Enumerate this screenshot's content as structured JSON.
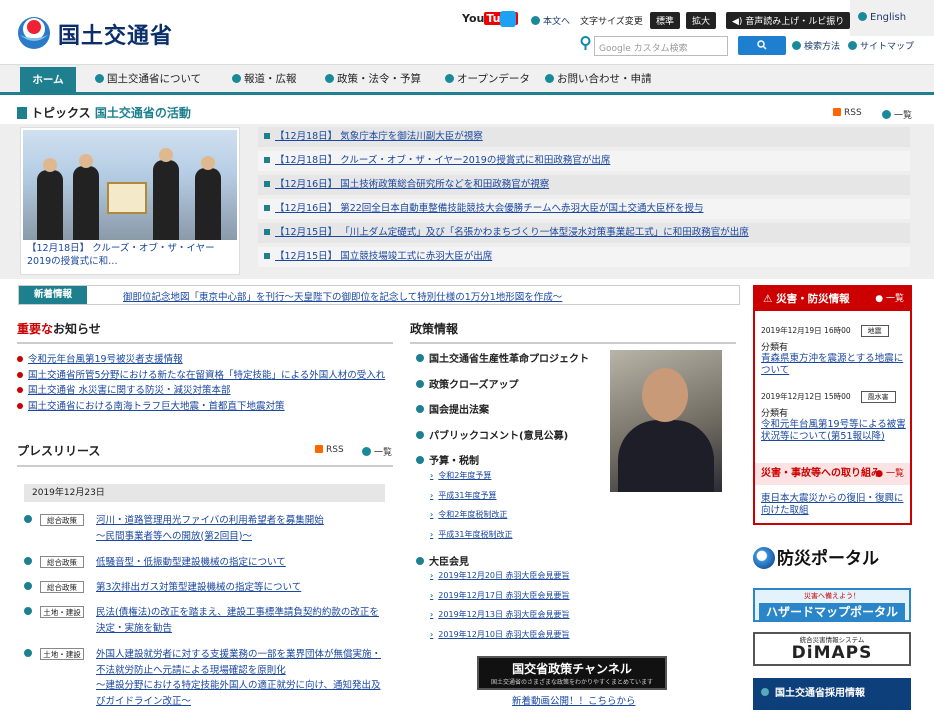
{
  "header": {
    "site_name": "国土交通省",
    "english": "English",
    "youtube": "You",
    "youtube_tube": "Tube",
    "skip_to_main": "本文へ",
    "font_size_label": "文字サイズ変更",
    "font_standard": "標準",
    "font_large": "拡大",
    "read_aloud": "音声読み上げ・ルビ振り",
    "search_placeholder": "Google カスタム検索",
    "search_method": "検索方法",
    "sitemap": "サイトマップ"
  },
  "nav": {
    "home": "ホーム",
    "items": [
      "国土交通省について",
      "報道・広報",
      "政策・法令・予算",
      "オープンデータ",
      "お問い合わせ・申請"
    ]
  },
  "topics": {
    "title": "トピックス",
    "subtitle": "国土交通省の活動",
    "rss": "RSS",
    "list_link": "一覧",
    "photo_caption": "【12月18日】 クルーズ・オブ・ザ・イヤー2019の授賞式に和…",
    "items": [
      "【12月18日】 気象庁本庁を御法川副大臣が視察",
      "【12月18日】 クルーズ・オブ・ザ・イヤー2019の授賞式に和田政務官が出席",
      "【12月16日】 国土技術政策総合研究所などを和田政務官が視察",
      "【12月16日】 第22回全日本自動車整備技能競技大会優勝チームへ赤羽大臣が国土交通大臣杯を授与",
      "【12月15日】 「川上ダム定礎式」及び「名張かわまちづくり一体型浸水対策事業起工式」に和田政務官が出席",
      "【12月15日】 国立競技場竣工式に赤羽大臣が出席"
    ]
  },
  "news": {
    "label": "新着情報",
    "text": "御即位記念地図「東京中心部」を刊行～天皇陛下の御即位を記念して特別仕様の1万分1地形図を作成～"
  },
  "notices": {
    "title_red": "重要な",
    "title_rest": "お知らせ",
    "items": [
      "令和元年台風第19号被災者支援情報",
      "国土交通省所管5分野における新たな在留資格「特定技能」による外国人材の受入れ",
      "国土交通省 水災害に関する防災・減災対策本部",
      "国土交通省における南海トラフ巨大地震・首都直下地震対策"
    ]
  },
  "press": {
    "title": "プレスリリース",
    "rss": "RSS",
    "list_link": "一覧",
    "date": "2019年12月23日",
    "rows": [
      {
        "tag": "総合政策",
        "text": "河川・道路管理用光ファイバの利用希望者を募集開始\n～民間事業者等への開放(第2回目)～"
      },
      {
        "tag": "総合政策",
        "text": "低騒音型・低振動型建設機械の指定について"
      },
      {
        "tag": "総合政策",
        "text": "第3次排出ガス対策型建設機械の指定等について"
      },
      {
        "tag": "土地・建設",
        "text": "民法(債権法)の改正を踏まえ、建設工事標準請負契約約款の改正を決定・実施を勧告"
      },
      {
        "tag": "土地・建設",
        "text": "外国人建設就労者に対する支援業務の一部を業界団体が無償実施・不法就労防止へ元請による現場確認を原則化\n～建設分野における特定技能外国人の適正就労に向け、通知発出及びガイドライン改正～"
      }
    ]
  },
  "policy": {
    "title": "政策情報",
    "items": {
      "p1": "国土交通省生産性革命プロジェクト",
      "p2": "政策クローズアップ",
      "p3": "国会提出法案",
      "p4": "パブリックコメント(意見公募)",
      "p5": "予算・税制",
      "p6": "大臣会見"
    },
    "budget": [
      "令和2年度予算",
      "平成31年度予算",
      "令和2年度税制改正",
      "平成31年度税制改正"
    ],
    "minister": [
      "2019年12月20日 赤羽大臣会見要旨",
      "2019年12月17日 赤羽大臣会見要旨",
      "2019年12月13日 赤羽大臣会見要旨",
      "2019年12月10日 赤羽大臣会見要旨"
    ],
    "channel_title": "国交省政策チャンネル",
    "channel_sub": "国土交通省のさまざまな政策をわかりやすくまとめています",
    "channel_link": "新着動画公開！！こちらから"
  },
  "sidebar": {
    "disaster_title": "災害・防災情報",
    "list_link": "一覧",
    "items": [
      {
        "date": "2019年12月19日 16時00",
        "tag": "地震",
        "kind": "分類有",
        "text": "青森県東方沖を震源とする地震について"
      },
      {
        "date": "2019年12月12日 15時00",
        "tag": "風水害",
        "kind": "分類有",
        "text": "令和元年台風第19号等による被害状況等について(第51報以降)"
      }
    ],
    "accident_title": "災害・事故等への取り組み",
    "accident_link": "一覧",
    "accident_item": "東日本大震災からの復旧・復興に向けた取組",
    "bosai_portal": "防災ポータル",
    "hazard_small": "災害へ備えよう！",
    "hazard_main": "ハザードマップポータル",
    "dimaps_small": "統合災害情報システム",
    "dimaps_main": "DiMAPS",
    "recruit": "国土交通省採用情報"
  }
}
